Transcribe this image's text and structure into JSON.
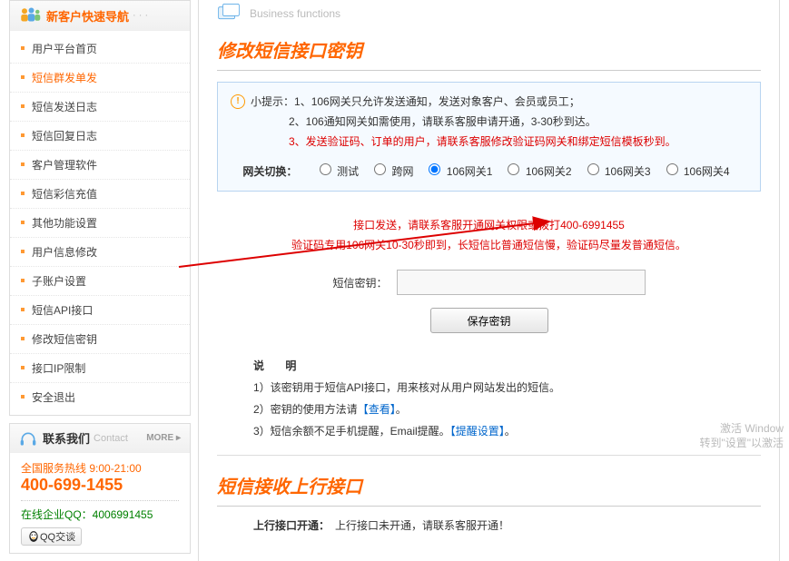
{
  "sidebar": {
    "nav_header_main": "新客户快速导航",
    "nav_header_dots": "· · ·",
    "items": [
      "用户平台首页",
      "短信群发单发",
      "短信发送日志",
      "短信回复日志",
      "客户管理软件",
      "短信彩信充值",
      "其他功能设置",
      "用户信息修改",
      "子账户设置",
      "短信API接口",
      "修改短信密钥",
      "接口IP限制",
      "安全退出"
    ],
    "active_index": 1,
    "contact_header_main": "联系我们",
    "contact_header_sub": "Contact",
    "more_label": "MORE",
    "hotline_label": "全国服务热线 9:00-21:00",
    "hotline_number": "400-699-1455",
    "qq_label": "在线企业QQ：4006991455",
    "qq_button": "QQ交谈"
  },
  "main": {
    "biz_func_label": "Business functions",
    "section1_title": "修改短信接口密钥",
    "tip_label": "小提示：",
    "tip_line1": "1、106网关只允许发送通知，发送对象客户、会员或员工；",
    "tip_line2": "2、106通知网关如需使用，请联系客服申请开通，3-30秒到达。",
    "tip_line3": "3、发送验证码、订单的用户，请联系客服修改验证码网关和绑定短信模板秒到。",
    "gateway_label": "网关切换：",
    "gateway_opts": [
      "测试",
      "跨网",
      "106网关1",
      "106网关2",
      "106网关3",
      "106网关4"
    ],
    "gateway_selected": 2,
    "notice1": "接口发送，请联系客服开通网关权限或拨打400-6991455",
    "notice2": "验证码专用106网关10-30秒即到，长短信比普通短信慢，验证码尽量发普通短信。",
    "key_label": "短信密钥：",
    "key_value": "",
    "save_btn": "保存密钥",
    "desc_hd": "说 明",
    "desc1_a": "1）该密钥用于短信API接口，用来核对从用户网站发出的短信。",
    "desc2_a": "2）密钥的使用方法请",
    "desc2_link": "【查看】",
    "desc2_b": "。",
    "desc3_a": "3）短信余额不足手机提醒，Email提醒。",
    "desc3_link": "【提醒设置】",
    "desc3_b": "。",
    "section2_title": "短信接收上行接口",
    "upline_label": "上行接口开通：",
    "upline_text": "上行接口未开通，请联系客服开通！"
  },
  "watermark": {
    "l1": "激活 Window",
    "l2": "转到\"设置\"以激活"
  }
}
